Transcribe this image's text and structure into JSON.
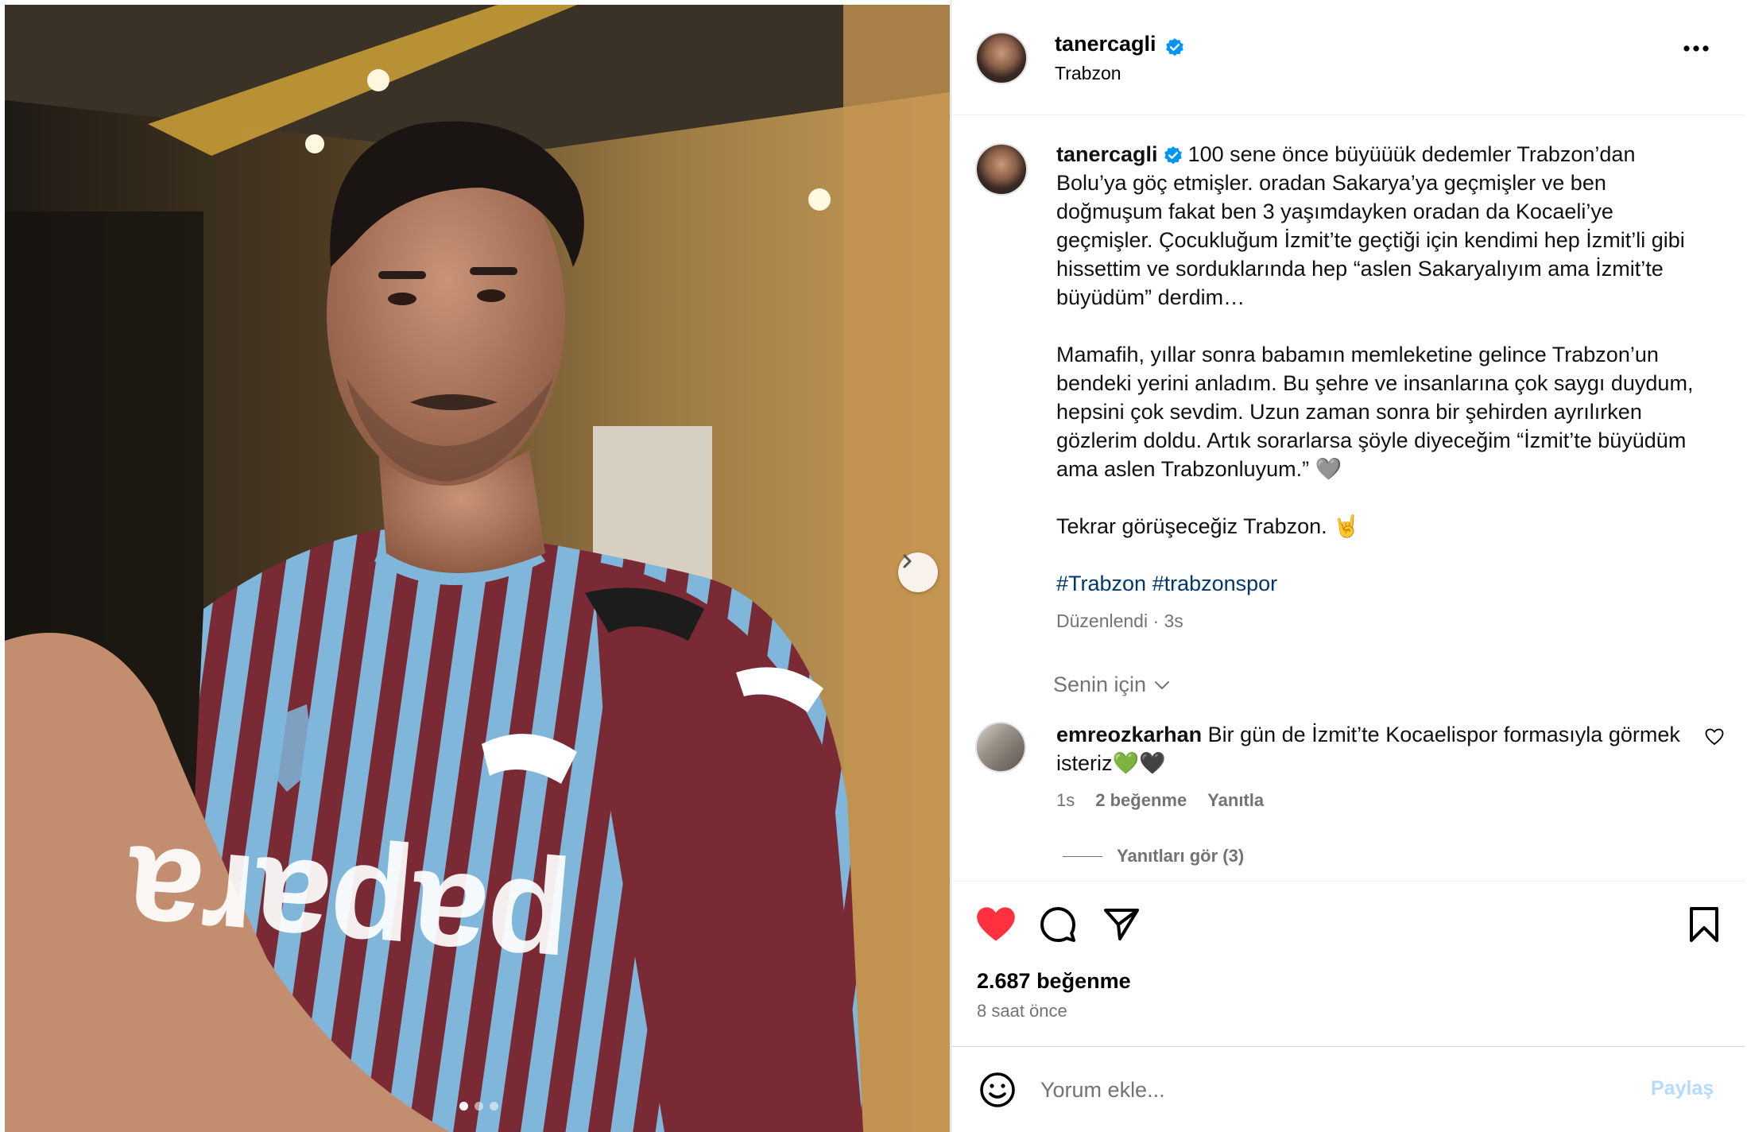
{
  "post": {
    "username": "tanercagli",
    "location": "Trabzon",
    "photo_alt": "",
    "carousel": {
      "count": 3,
      "active": 1
    }
  },
  "caption": {
    "username": "tanercagli",
    "para1": "100 sene önce büyüüük dedemler Trabzon’dan Bolu’ya göç etmişler. oradan Sakarya’ya geçmişler ve ben doğmuşum fakat ben 3 yaşımdayken oradan da Kocaeli’ye geçmişler. Çocukluğum İzmit’te geçtiği için kendimi hep İzmit’li gibi hissettim ve sorduklarında hep “aslen Sakaryalıyım ama İzmit’te büyüdüm” derdim…",
    "para2": "Mamafih, yıllar sonra babamın memleketine gelince Trabzon’un bendeki yerini anladım. Bu şehre ve insanlarına çok saygı duydum, hepsini çok sevdim. Uzun zaman sonra bir şehirden ayrılırken gözlerim doldu. Artık sorarlarsa şöyle diyeceğim “İzmit’te büyüdüm ama aslen Trabzonluyum.” 🩶",
    "para3": "Tekrar görüşeceğiz Trabzon. 🤘",
    "hashtags": "#Trabzon #trabzonspor",
    "edited": "Düzenlendi · 3s"
  },
  "sort_label": "Senin için",
  "comment": {
    "username": "emreozkarhan",
    "text": "Bir gün de İzmit’te Kocaelispor formasıyla görmek isteriz💚🖤",
    "time": "1s",
    "likes": "2 beğenme",
    "reply": "Yanıtla",
    "view_replies": "Yanıtları gör (3)"
  },
  "actions": {
    "liked": true,
    "likes_text": "2.687 beğenme",
    "time_ago": "8 saat önce"
  },
  "add_comment": {
    "placeholder": "Yorum ekle...",
    "share_label": "Paylaş"
  },
  "colors": {
    "like_red": "#ff3040",
    "verified_blue": "#0095f6",
    "link_blue": "#00376b",
    "muted": "#737373",
    "jersey_maroon": "#7a2a35",
    "jersey_blue": "#7fb6da"
  }
}
